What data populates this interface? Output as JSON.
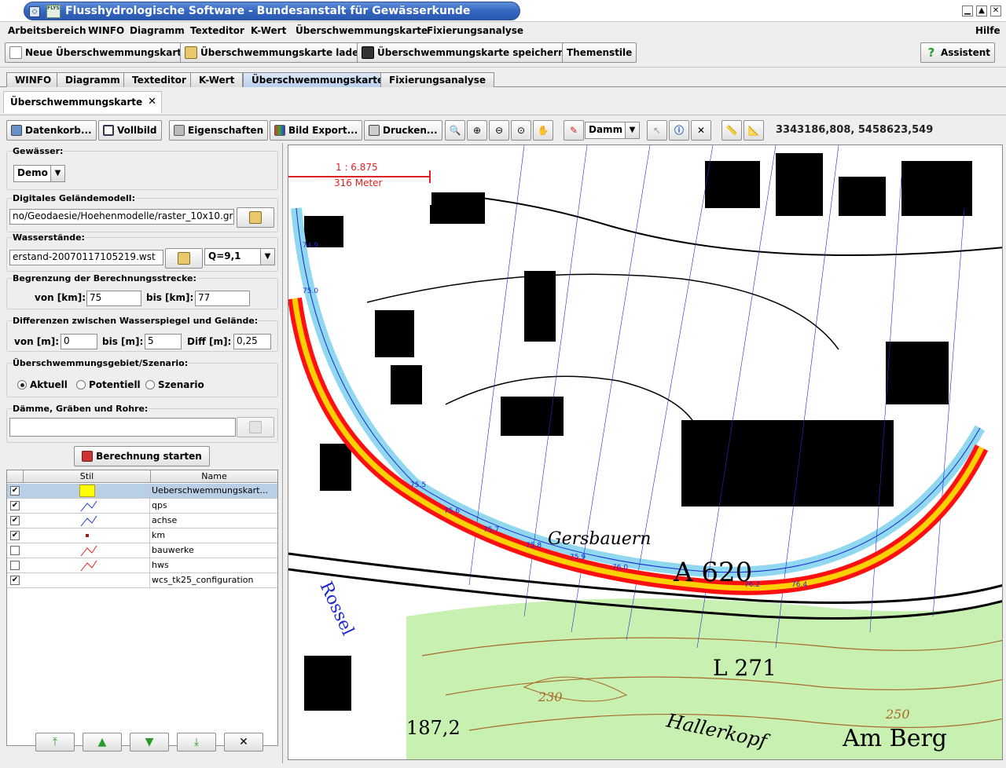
{
  "window": {
    "title": "Flusshydrologische Software - Bundesanstalt für Gewässerkunde",
    "logo_text": "FLYS"
  },
  "menu": {
    "items": [
      "Arbeitsbereich",
      "WINFO",
      "Diagramm",
      "Texteditor",
      "K-Wert",
      "Überschwemmungskarte",
      "Fixierungsanalyse"
    ],
    "help": "Hilfe"
  },
  "toolbar": {
    "new_map": "Neue Überschwemmungskarte",
    "load_map": "Überschwemmungskarte laden",
    "save_map": "Überschwemmungskarte speichern",
    "theme_styles": "Themenstile",
    "assistant": "Assistent"
  },
  "tabs": [
    "WINFO",
    "Diagramm",
    "Texteditor",
    "K-Wert",
    "Überschwemmungskarte",
    "Fixierungsanalyse"
  ],
  "active_tab": "Überschwemmungskarte",
  "subtab": "Überschwemmungskarte",
  "map_toolbar": {
    "data_basket": "Datenkorb...",
    "fullscreen": "Vollbild",
    "properties": "Eigenschaften",
    "image_export": "Bild Export...",
    "print": "Drucken...",
    "layer_select": "Damm",
    "coordinates": "3343186,808, 5458623,549"
  },
  "panel": {
    "waters_label": "Gewässer:",
    "waters_value": "Demo",
    "dem_label": "Digitales Geländemodell:",
    "dem_value": "no/Geodaesie/Hoehenmodelle/raster_10x10.grd",
    "water_levels_label": "Wasserstände:",
    "water_levels_value": "erstand-20070117105219.wst",
    "discharge_value": "Q=9,1",
    "range_label": "Begrenzung der Berechnungsstrecke:",
    "from_km_label": "von [km]:",
    "from_km_value": "75",
    "to_km_label": "bis [km]:",
    "to_km_value": "77",
    "diff_label": "Differenzen zwischen Wasserspiegel und Gelände:",
    "from_m_label": "von [m]:",
    "from_m_value": "0",
    "to_m_label": "bis [m]:",
    "to_m_value": "5",
    "diff_m_label": "Diff [m]:",
    "diff_m_value": "0,25",
    "scenario_label": "Überschwemmungsgebiet/Szenario:",
    "scenario_options": [
      "Aktuell",
      "Potentiell",
      "Szenario"
    ],
    "dikes_label": "Dämme, Gräben und Rohre:",
    "compute_button": "Berechnung starten"
  },
  "layers": {
    "col_style": "Stil",
    "col_name": "Name",
    "rows": [
      {
        "name": "Ueberschwemmungskart...",
        "checked": true,
        "selected": true
      },
      {
        "name": "qps",
        "checked": true,
        "selected": false
      },
      {
        "name": "achse",
        "checked": true,
        "selected": false
      },
      {
        "name": "km",
        "checked": true,
        "selected": false
      },
      {
        "name": "bauwerke",
        "checked": false,
        "selected": false
      },
      {
        "name": "hws",
        "checked": false,
        "selected": false
      },
      {
        "name": "wcs_tk25_configuration",
        "checked": true,
        "selected": false
      }
    ]
  },
  "map": {
    "scale": "1 : 6.875",
    "scale_bar": "316 Meter",
    "labels": [
      "Rossel",
      "Gersbauern",
      "A 620",
      "L 271",
      "Hallerkopf",
      "Am Berg",
      "187,2",
      "230",
      "250"
    ],
    "km_marks": [
      "74.9",
      "75.0",
      "75.5",
      "75.6",
      "75.7",
      "75.8",
      "75.9",
      "76.0",
      "76.2",
      "76.4"
    ]
  }
}
